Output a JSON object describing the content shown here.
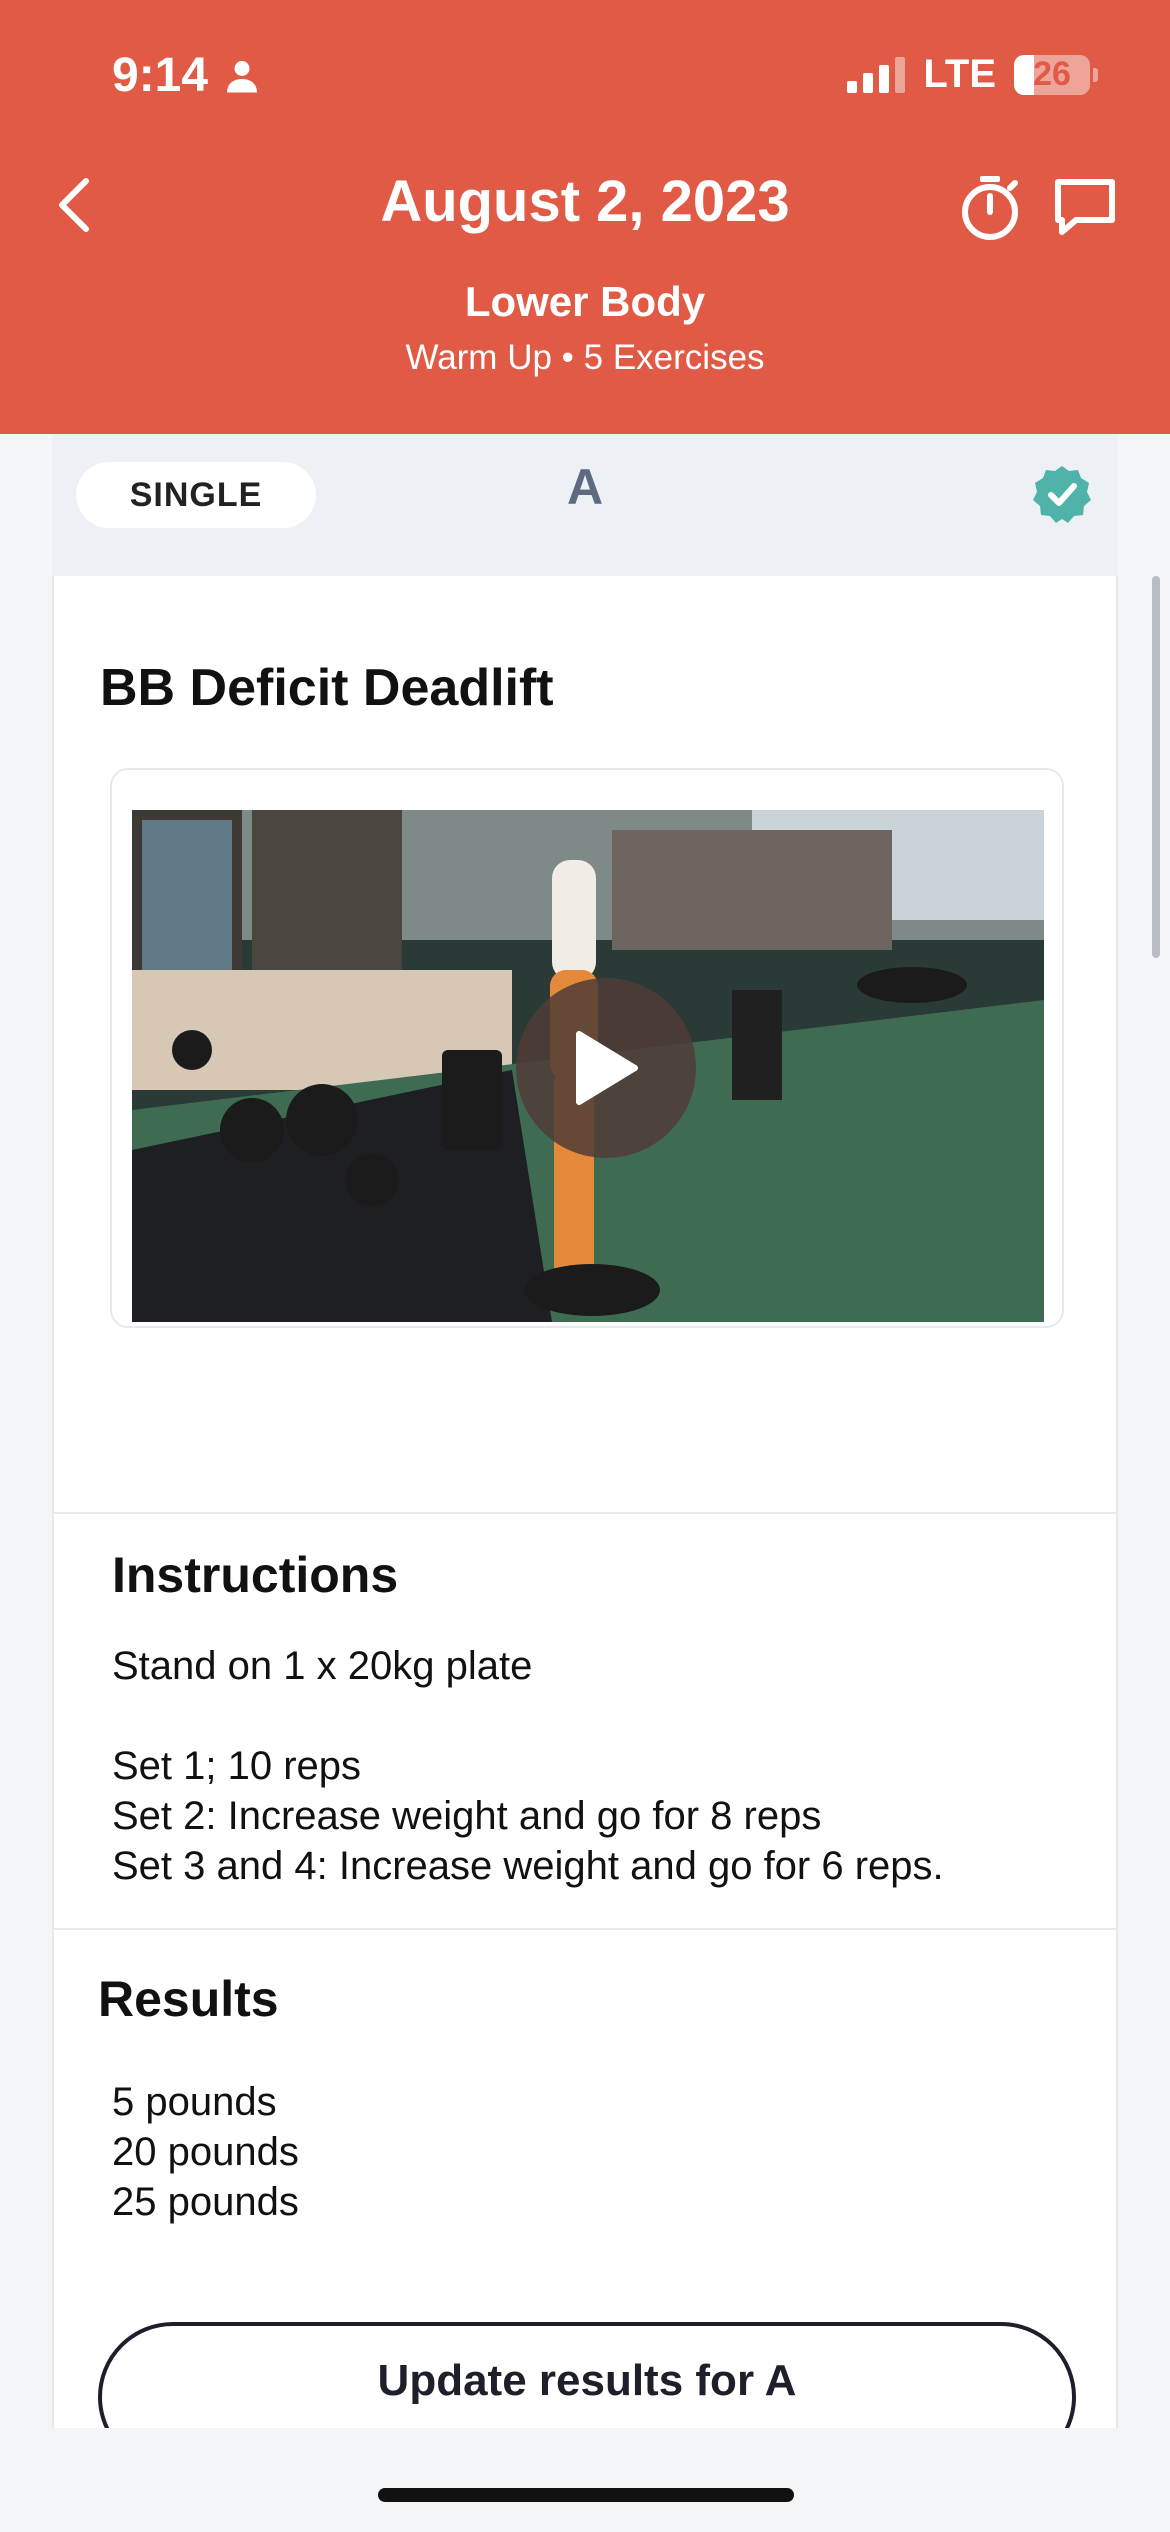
{
  "status_bar": {
    "time": "9:14",
    "network": "LTE",
    "battery": "26"
  },
  "header": {
    "title": "August 2, 2023",
    "subtitle": "Lower Body",
    "meta": "Warm Up • 5 Exercises",
    "background_color": "#e05a46"
  },
  "segment": {
    "type_label": "SINGLE",
    "letter": "A",
    "completed": true,
    "check_color": "#4fb3a9"
  },
  "exercise": {
    "name": "BB Deficit Deadlift",
    "video": {
      "state": "paused",
      "play_icon": "play-icon"
    }
  },
  "instructions": {
    "heading": "Instructions",
    "lines": [
      "Stand on 1 x 20kg plate",
      "Set 1; 10 reps",
      "Set 2: Increase weight and go for 8 reps",
      "Set 3 and 4: Increase weight and go for 6 reps."
    ]
  },
  "results": {
    "heading": "Results",
    "lines": [
      "5 pounds",
      "20 pounds",
      "25 pounds"
    ]
  },
  "actions": {
    "update_label": "Update results for A"
  }
}
